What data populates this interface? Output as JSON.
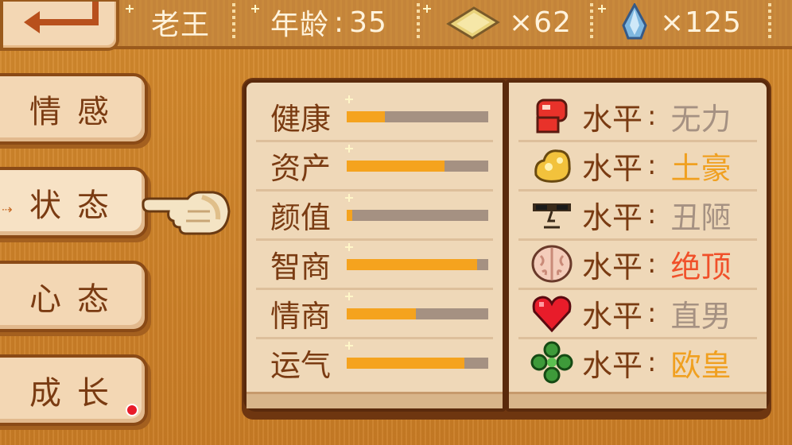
{
  "header": {
    "player_name": "老王",
    "age_label": "年龄",
    "age_value": "35",
    "gold_count": "×62",
    "gem_count": "×125"
  },
  "tabs": [
    {
      "label": "情感",
      "active": false,
      "badge": false
    },
    {
      "label": "状态",
      "active": true,
      "badge": false
    },
    {
      "label": "心态",
      "active": false,
      "badge": false
    },
    {
      "label": "成长",
      "active": false,
      "badge": true
    }
  ],
  "stats": [
    {
      "label": "健康",
      "value": 0.27
    },
    {
      "label": "资产",
      "value": 0.69
    },
    {
      "label": "颜值",
      "value": 0.04
    },
    {
      "label": "智商",
      "value": 0.92
    },
    {
      "label": "情商",
      "value": 0.49
    },
    {
      "label": "运气",
      "value": 0.83
    }
  ],
  "levels": [
    {
      "icon": "muscle-icon",
      "key": "水平",
      "value": "无力",
      "color": "#a59182"
    },
    {
      "icon": "gold-nugget-icon",
      "key": "水平",
      "value": "土豪",
      "color": "#f0a020"
    },
    {
      "icon": "face-icon",
      "key": "水平",
      "value": "丑陋",
      "color": "#a59182"
    },
    {
      "icon": "brain-icon",
      "key": "水平",
      "value": "绝顶",
      "color": "#f0502a"
    },
    {
      "icon": "heart-icon",
      "key": "水平",
      "value": "直男",
      "color": "#a59182"
    },
    {
      "icon": "clover-icon",
      "key": "水平",
      "value": "欧皇",
      "color": "#f0a020"
    }
  ],
  "colors": {
    "bar_fill": "#f5a31e",
    "bar_track": "#a59182",
    "text_brown": "#7a3b12"
  }
}
